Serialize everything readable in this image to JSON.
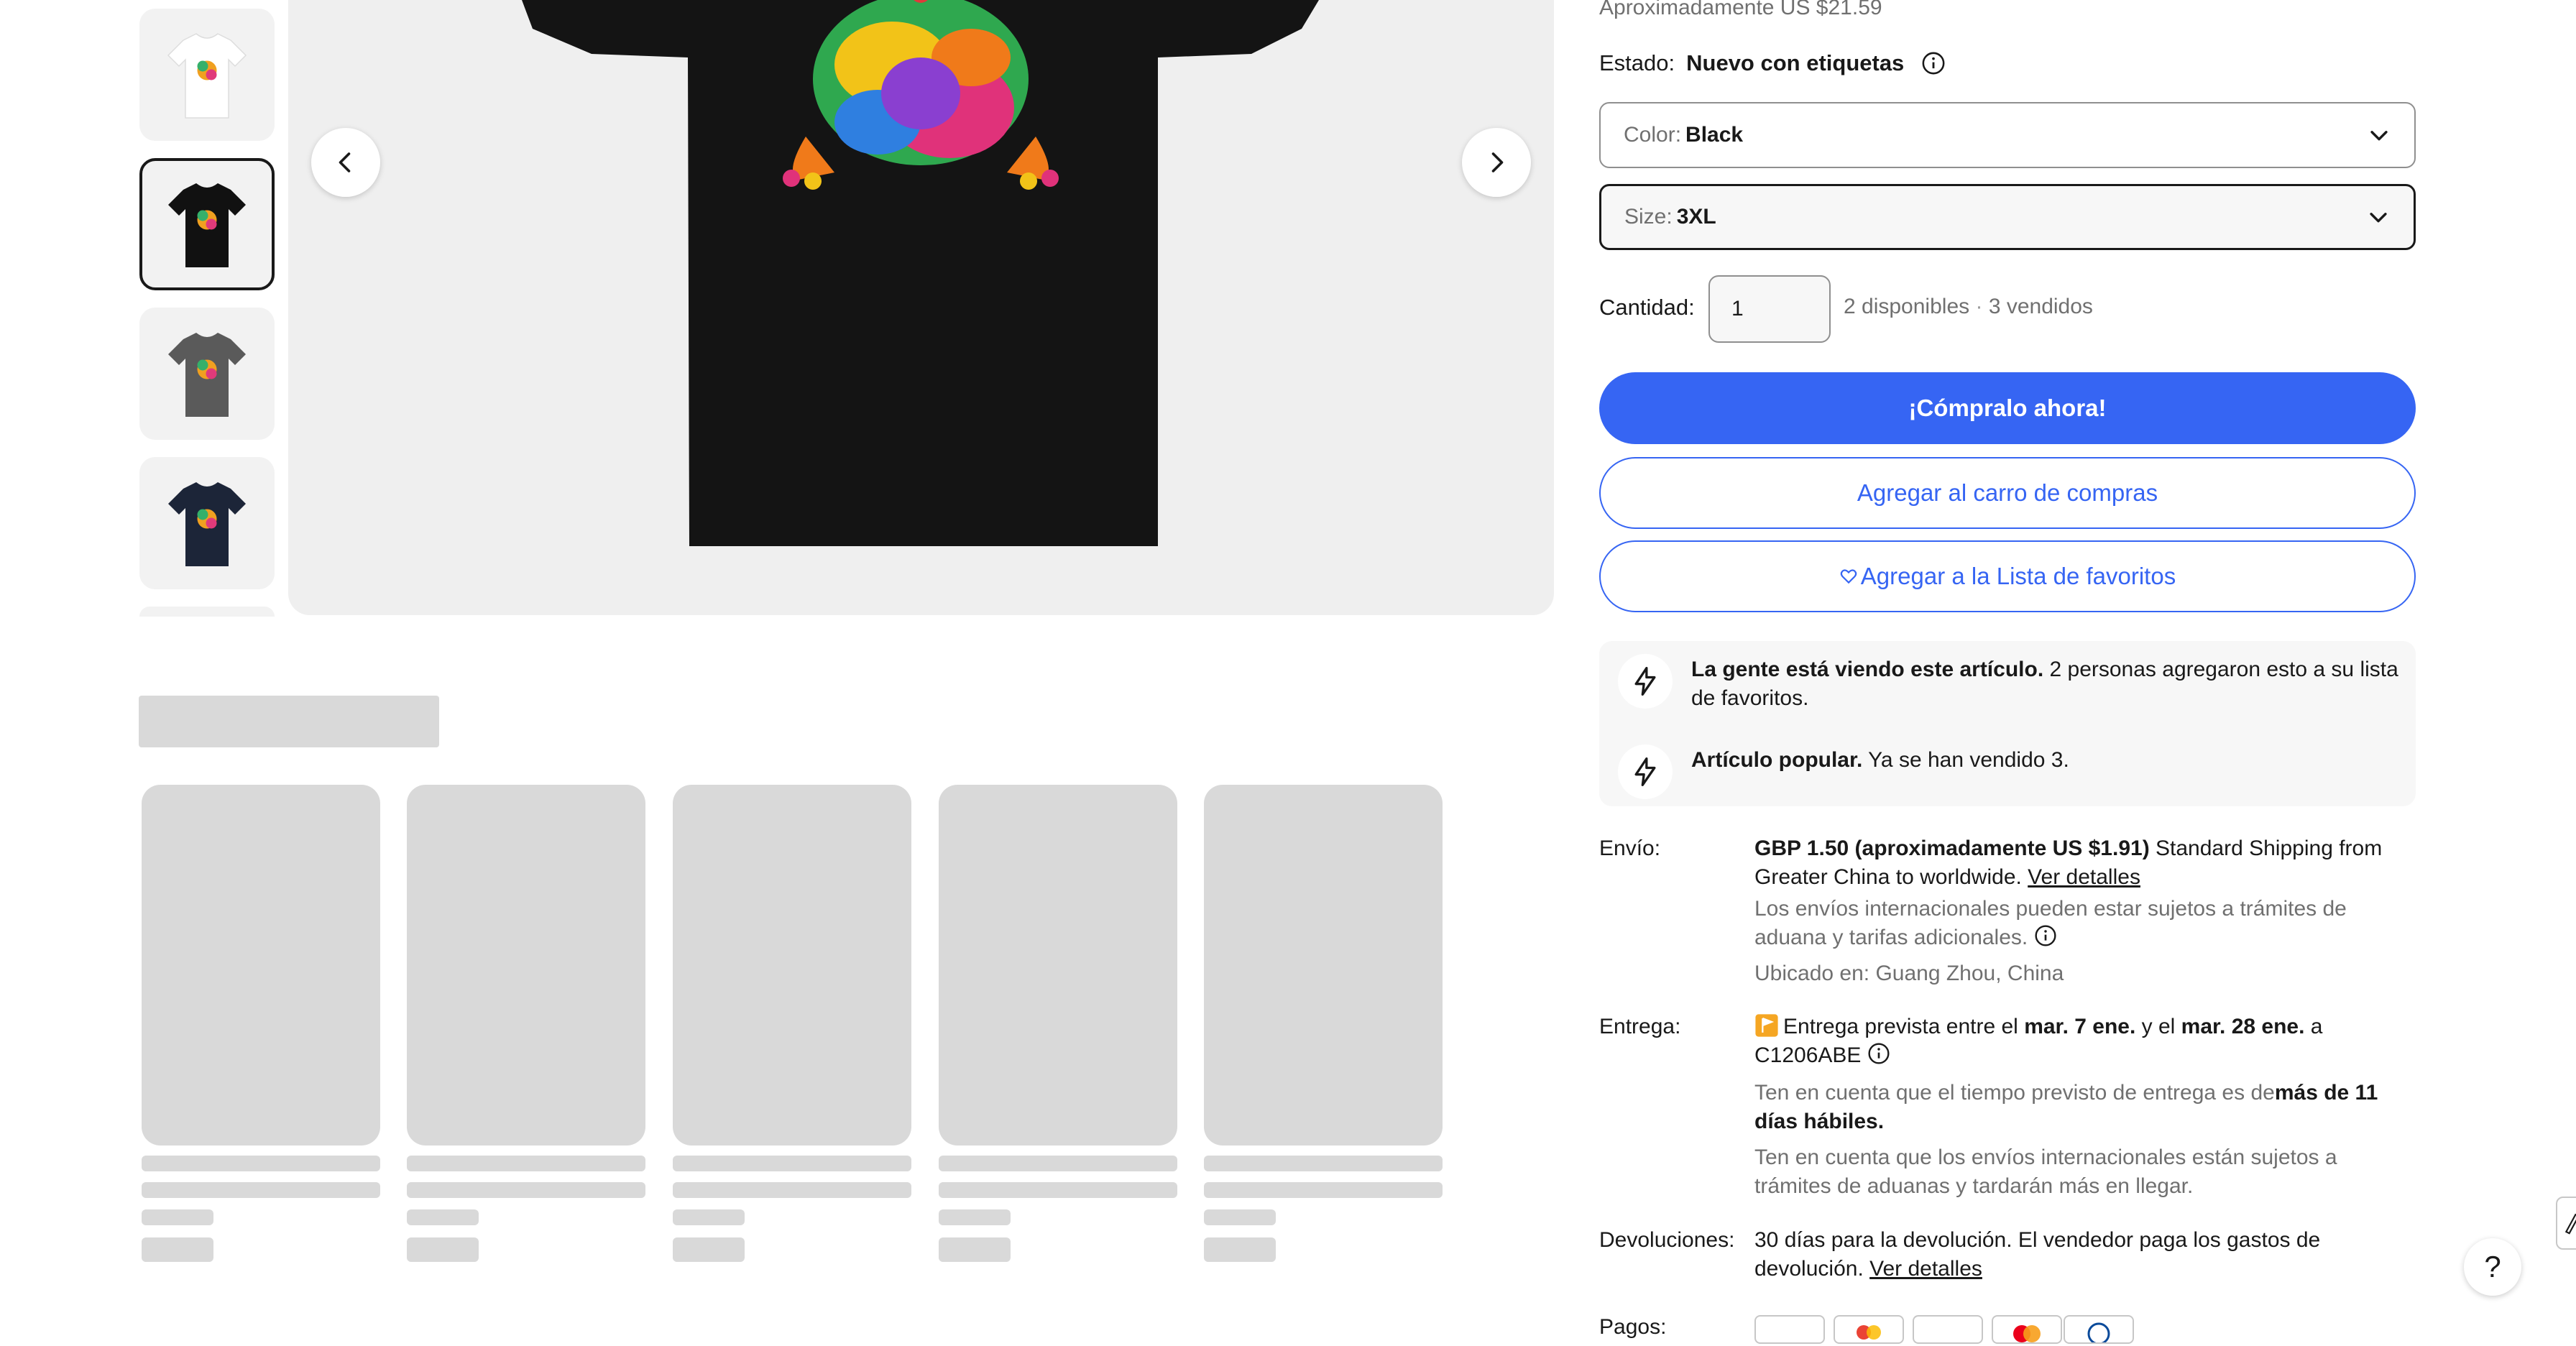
{
  "price": {
    "approx_text": "Aproximadamente US $21.59"
  },
  "condition": {
    "label": "Estado:",
    "value": "Nuevo con etiquetas"
  },
  "variations": {
    "color_label": "Color:",
    "color_value": "Black",
    "size_label": "Size:",
    "size_value": "3XL"
  },
  "quantity": {
    "label": "Cantidad:",
    "value": "1",
    "available": "2 disponibles",
    "separator": "·",
    "sold": "3 vendidos"
  },
  "actions": {
    "buy_now": "¡Cómpralo ahora!",
    "add_to_cart": "Agregar al carro de compras",
    "add_to_watchlist": "Agregar a la Lista de favoritos"
  },
  "signals": [
    {
      "bold": "La gente está viendo este artículo.",
      "text": " 2 personas agregaron esto a su lista de favoritos."
    },
    {
      "bold": "Artículo popular.",
      "text": " Ya se han vendido 3."
    }
  ],
  "shipping": {
    "label": "Envío:",
    "cost_bold": "GBP 1.50 (aproximadamente US $1.91)",
    "cost_text": " Standard Shipping from Greater China to worldwide. ",
    "details_link": "Ver detalles",
    "customs_note": "Los envíos internacionales pueden estar sujetos a trámites de aduana y tarifas adicionales.",
    "location": "Ubicado en: Guang Zhou, China"
  },
  "delivery": {
    "label": "Entrega:",
    "prefix": "Entrega prevista entre el ",
    "date_start": "mar. 7 ene.",
    "middle": " y el ",
    "date_end": "mar. 28 ene.",
    "suffix": " a",
    "postcode": "C1206ABE",
    "note1_text": "Ten en cuenta que el tiempo previsto de entrega es de",
    "note1_bold": "más de 11 días hábiles.",
    "note2": "Ten en cuenta que los envíos internacionales están sujetos a trámites de aduanas y tardarán más en llegar."
  },
  "returns": {
    "label": "Devoluciones:",
    "text": "30 días para la devolución. El vendedor paga los gastos de devolución. ",
    "details_link": "Ver detalles"
  },
  "payments": {
    "label": "Pagos:"
  },
  "gallery": {
    "thumbnail_colors": [
      "#e6e6ec",
      "#111111",
      "#5a5a5a",
      "#1c2538"
    ],
    "selected_index": 1
  },
  "help": {
    "label": "?"
  },
  "colors": {
    "accent": "#3665f3",
    "skeleton": "#d9d9d9",
    "text": "#191919",
    "muted": "#707070"
  }
}
